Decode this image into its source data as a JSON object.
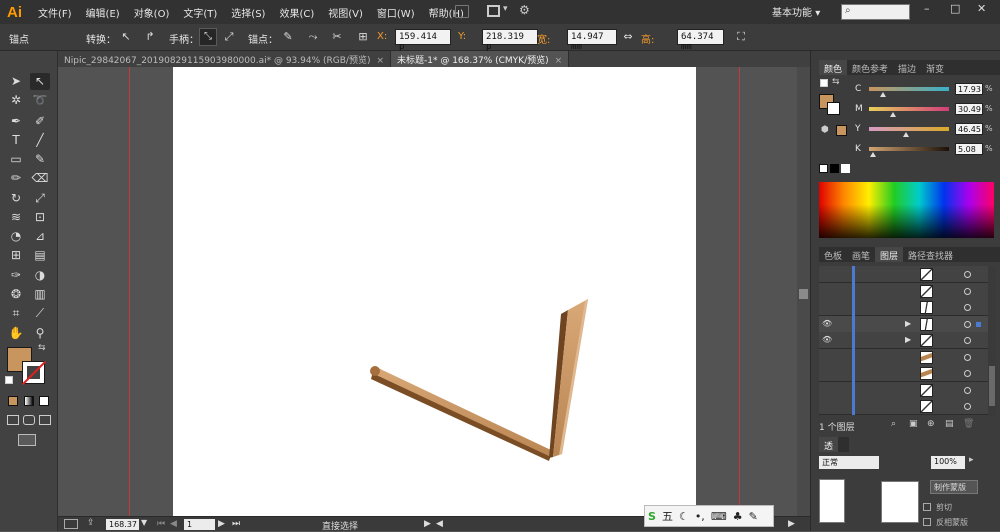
{
  "app": {
    "logo": "Ai",
    "workspace": "基本功能",
    "workspace_arrow": "▾",
    "search_placeholder": ""
  },
  "menu": [
    "文件(F)",
    "编辑(E)",
    "对象(O)",
    "文字(T)",
    "选择(S)",
    "效果(C)",
    "视图(V)",
    "窗口(W)",
    "帮助(H)"
  ],
  "control": {
    "mode": "锚点",
    "convert_label": "转换：",
    "handles_label": "手柄：",
    "anchor_label": "锚点：",
    "x_label": "X:",
    "x_value": "159.414 p",
    "y_label": "Y:",
    "y_value": "218.319 p",
    "w_label": "宽:",
    "w_value": "14.947 mm",
    "h_label": "高:",
    "h_value": "64.374 mm"
  },
  "tabs": [
    {
      "label": "Nipic_29842067_20190829115903980000.ai* @ 93.94% (RGB/预览)",
      "close": "×",
      "active": false
    },
    {
      "label": "未标题-1* @ 168.37% (CMYK/预览)",
      "close": "×",
      "active": true
    }
  ],
  "status": {
    "zoom": "168.37",
    "page": "1",
    "tool": "直接选择"
  },
  "color_panel": {
    "tabs": [
      "颜色",
      "颜色参考",
      "描边",
      "渐变"
    ],
    "channels": [
      {
        "name": "C",
        "value": "17.93",
        "unit": "%",
        "fraction": 0.18
      },
      {
        "name": "M",
        "value": "30.49",
        "unit": "%",
        "fraction": 0.3
      },
      {
        "name": "Y",
        "value": "46.45",
        "unit": "%",
        "fraction": 0.46
      },
      {
        "name": "K",
        "value": "5.08",
        "unit": "%",
        "fraction": 0.05
      }
    ],
    "fill_color": "#c8955e"
  },
  "layers_panel": {
    "tabs": [
      "色板",
      "画笔",
      "图层",
      "路径查找器"
    ],
    "rows": [
      {
        "visible": false,
        "expand": false,
        "selected": false,
        "thumb": "stroke-diag"
      },
      {
        "visible": false,
        "expand": false,
        "selected": false,
        "thumb": "stroke-diag"
      },
      {
        "visible": false,
        "expand": false,
        "selected": false,
        "thumb": "stroke-vert"
      },
      {
        "visible": true,
        "expand": true,
        "selected": true,
        "thumb": "stroke-vert"
      },
      {
        "visible": true,
        "expand": true,
        "selected": false,
        "thumb": "stroke-diag"
      },
      {
        "visible": false,
        "expand": false,
        "selected": false,
        "thumb": "fill-brown"
      },
      {
        "visible": false,
        "expand": false,
        "selected": false,
        "thumb": "fill-brown"
      },
      {
        "visible": false,
        "expand": false,
        "selected": false,
        "thumb": "stroke-diag"
      },
      {
        "visible": false,
        "expand": false,
        "selected": false,
        "thumb": "stroke-diag"
      }
    ],
    "footer": "1 个图层"
  },
  "transparency_panel": {
    "tab": "透",
    "blend": "正常",
    "opacity": "100%",
    "make_mask": "制作蒙版",
    "clip": "剪切",
    "invert_mask": "反相蒙版"
  },
  "ime": {
    "label": "五"
  }
}
